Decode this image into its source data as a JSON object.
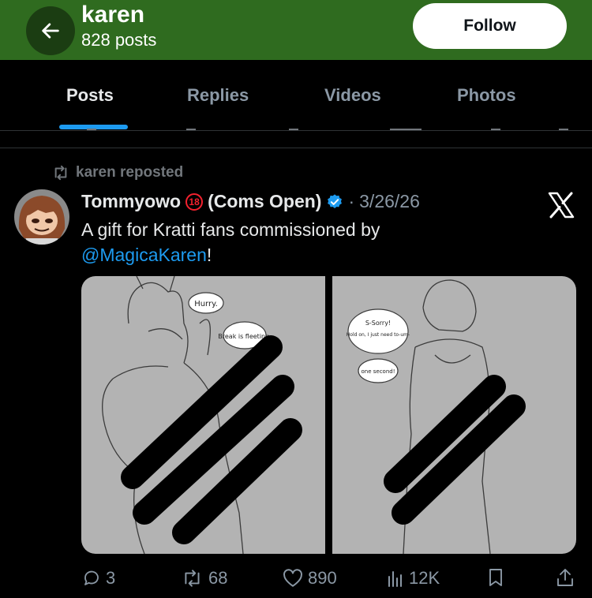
{
  "header": {
    "title": "karen",
    "subtitle": "828 posts",
    "follow_label": "Follow"
  },
  "tabs": [
    {
      "label": "Posts",
      "active": true
    },
    {
      "label": "Replies",
      "active": false
    },
    {
      "label": "Videos",
      "active": false
    },
    {
      "label": "Photos",
      "active": false
    }
  ],
  "post": {
    "repost_text": "karen reposted",
    "author": "Tommyowo",
    "author_suffix": "(Coms Open)",
    "age_badge": "18",
    "separator": "·",
    "date": "3/26/26",
    "text_before": "A gift for Kratti fans commissioned by",
    "mention": "@MagicaKaren",
    "text_after": "!",
    "source_icon": "x-logo-icon",
    "media": {
      "left_bubbles": [
        "Hurry.",
        "Break is fleeting."
      ],
      "right_bubbles": [
        "S-Sorry!",
        "Hold on, I just need to-um-",
        "one second!"
      ]
    },
    "stats": {
      "replies": "3",
      "reposts": "68",
      "likes": "890",
      "views": "12K"
    }
  },
  "colors": {
    "header_bg": "#2f6b1f",
    "accent": "#1d9bf0",
    "muted": "#8b98a5"
  }
}
